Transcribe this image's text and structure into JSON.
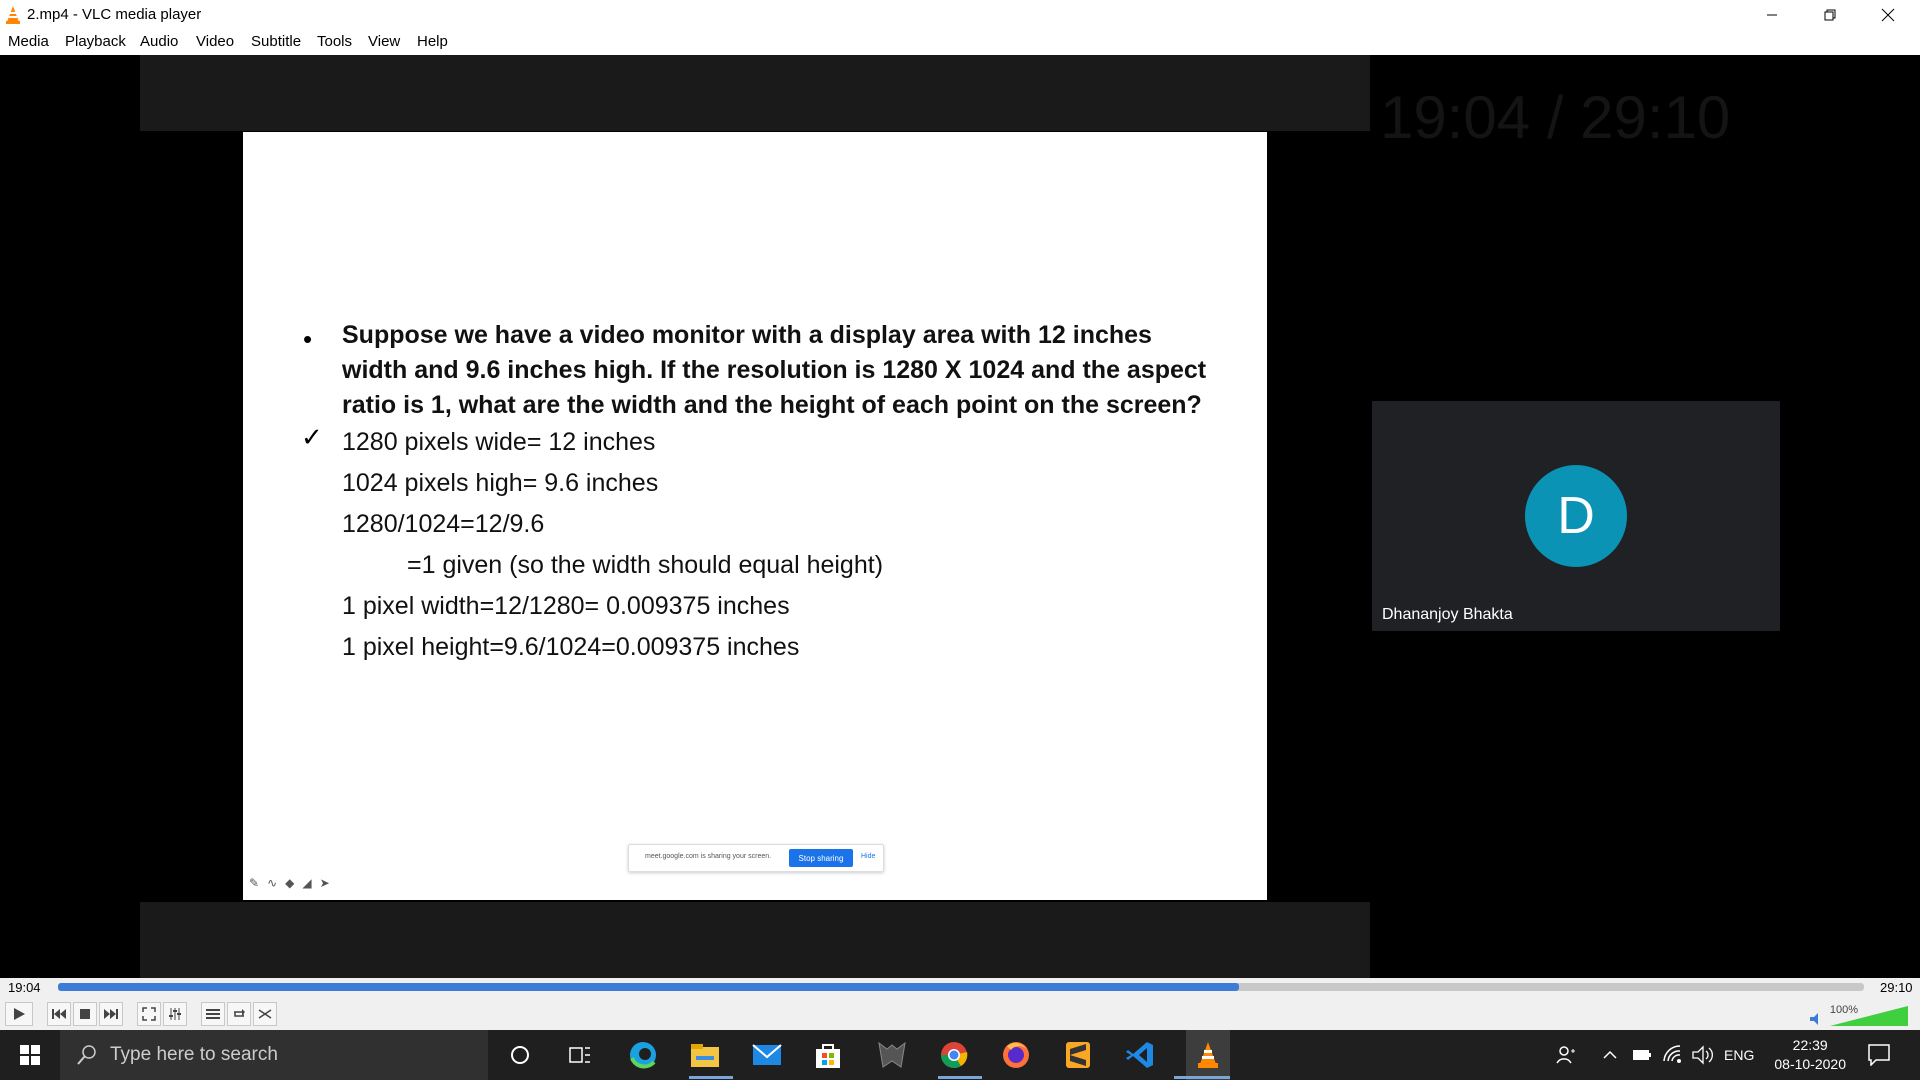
{
  "window": {
    "title": "2.mp4 - VLC media player",
    "colors": {
      "accent": "#ff8800",
      "seek": "#3d7cd6"
    }
  },
  "menu": [
    "Media",
    "Playback",
    "Audio",
    "Video",
    "Subtitle",
    "Tools",
    "View",
    "Help"
  ],
  "video": {
    "time_overlay": "19:04 / 29:10",
    "slide": {
      "question": "Suppose we have a video monitor with a display area with 12 inches width and 9.6 inches high. If the resolution is 1280 X 1024 and the aspect ratio is 1, what are the width and the height of each point on the screen?",
      "lines": [
        "1280 pixels wide= 12 inches",
        "1024 pixels high= 9.6 inches",
        "1280/1024=12/9.6",
        "=1 given (so the width should equal height)",
        "1 pixel width=12/1280= 0.009375 inches",
        "1 pixel height=9.6/1024=0.009375 inches"
      ],
      "share_bar": {
        "message": "meet.google.com is sharing your screen.",
        "stop_label": "Stop sharing",
        "hide_label": "Hide"
      }
    },
    "participant": {
      "initial": "D",
      "name": "Dhananjoy Bhakta",
      "avatar_color": "#0b93b5"
    }
  },
  "player": {
    "elapsed": "19:04",
    "total": "29:10",
    "progress": 0.654,
    "volume_label": "100%",
    "volume": 1.0
  },
  "taskbar": {
    "search_placeholder": "Type here to search",
    "language": "ENG",
    "time": "22:39",
    "date": "08-10-2020",
    "apps": [
      "task-view-icon",
      "edge-icon",
      "file-explorer-icon",
      "mail-icon",
      "store-icon",
      "game-app-icon",
      "chrome-icon",
      "firefox-icon",
      "sublime-text-icon",
      "vscode-icon",
      "vlc-icon"
    ]
  }
}
